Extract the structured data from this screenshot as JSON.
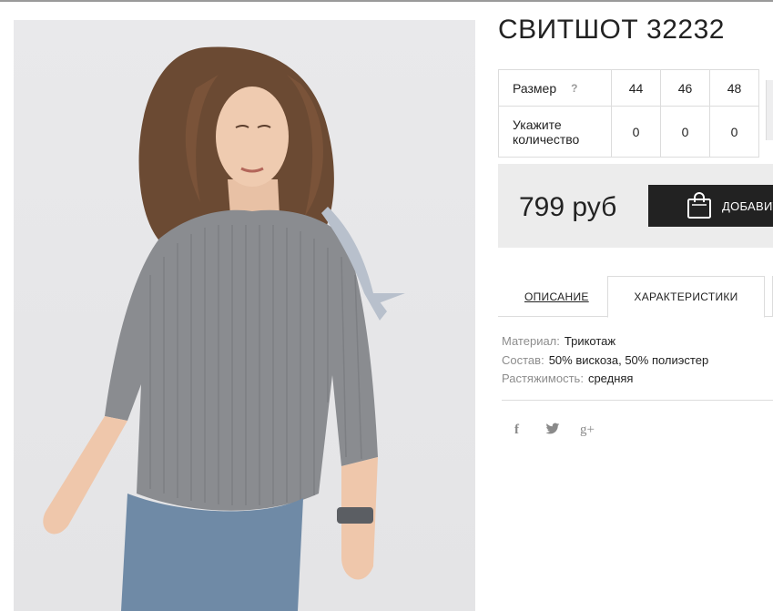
{
  "product": {
    "title": "СВИТШОТ 32232",
    "price": "799 руб",
    "add_button_label": "ДОБАВИТЬ"
  },
  "size_table": {
    "size_label": "Размер",
    "help_symbol": "?",
    "qty_label_line1": "Укажите",
    "qty_label_line2": "количество",
    "sizes": [
      "44",
      "46",
      "48"
    ],
    "quantities": [
      "0",
      "0",
      "0"
    ]
  },
  "tabs": {
    "description": "ОПИСАНИЕ",
    "characteristics": "ХАРАКТЕРИСТИКИ",
    "active": "characteristics"
  },
  "characteristics": [
    {
      "key": "Материал:",
      "value": "Трикотаж"
    },
    {
      "key": "Состав:",
      "value": "50% вискоза, 50% полиэстер"
    },
    {
      "key": "Растяжимость:",
      "value": "средняя"
    }
  ],
  "social": {
    "facebook_glyph": "f",
    "twitter_icon": "twitter-icon",
    "googleplus_glyph": "g+"
  },
  "colors": {
    "button_bg": "#222222",
    "price_box_bg": "#ececec",
    "border": "#dcdcdc",
    "label_gray": "#8d8d8d"
  }
}
